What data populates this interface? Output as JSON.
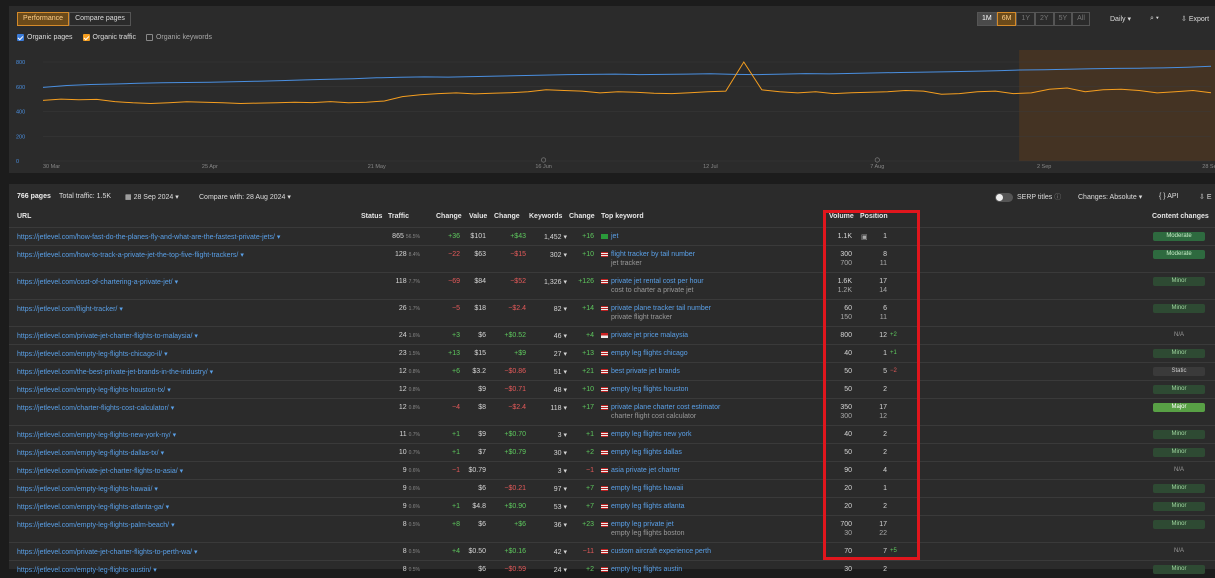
{
  "header": {
    "tabs": [
      {
        "label": "Performance",
        "active": true
      },
      {
        "label": "Compare pages",
        "active": false
      }
    ],
    "ranges": [
      {
        "label": "1M",
        "on": true
      },
      {
        "label": "6M",
        "on": true
      },
      {
        "label": "1Y",
        "on": false
      },
      {
        "label": "2Y",
        "on": false
      },
      {
        "label": "5Y",
        "on": false
      },
      {
        "label": "All",
        "on": false
      }
    ],
    "interval": "Daily",
    "export": "Export"
  },
  "metrics": {
    "organic_pages": "Organic pages",
    "organic_traffic": "Organic traffic",
    "organic_keywords": "Organic keywords"
  },
  "chart_data": {
    "type": "line",
    "y_ticks": [
      "800",
      "600",
      "400",
      "200",
      "0"
    ],
    "ylim": [
      0,
      800
    ],
    "x_ticks": [
      "30 Mar",
      "25 Apr",
      "21 May",
      "16 Jun",
      "12 Jul",
      "7 Aug",
      "2 Sep",
      "28 Sep"
    ],
    "series": [
      {
        "color": "#4a8fe0",
        "values": [
          595,
          610,
          618,
          622,
          628,
          632,
          634,
          636,
          640,
          645,
          650,
          655,
          660,
          665,
          672,
          676,
          680,
          678,
          682,
          686,
          690,
          694,
          698,
          700,
          702,
          698,
          700,
          702,
          705,
          700,
          698,
          702,
          706,
          704,
          708,
          712,
          715,
          718,
          722,
          726,
          730,
          735,
          738,
          742,
          745,
          748,
          750,
          752,
          758,
          765
        ]
      },
      {
        "color": "#f59e1f",
        "values": [
          490,
          500,
          495,
          498,
          480,
          470,
          465,
          470,
          478,
          475,
          470,
          465,
          468,
          470,
          475,
          472,
          480,
          470,
          475,
          485,
          520,
          535,
          545,
          550,
          542,
          548,
          552,
          560,
          575,
          570,
          565,
          550,
          560,
          555,
          548,
          545,
          552,
          560,
          565,
          800,
          575,
          560,
          550,
          560,
          545,
          552,
          555,
          560,
          570,
          565,
          540,
          545,
          560,
          565,
          545,
          550,
          580,
          590,
          560,
          575,
          580,
          570,
          550,
          560,
          570,
          552
        ]
      }
    ],
    "highlight_range": [
      "2 Sep",
      "28 Sep"
    ],
    "markers": [
      "16 Jun",
      "7 Aug"
    ]
  },
  "table": {
    "summary": {
      "pages": "766 pages",
      "total_traffic": "Total traffic: 1.5K",
      "date": "28 Sep 2024",
      "compare": "Compare with: 28 Aug 2024",
      "serp_titles": "SERP titles",
      "changes": "Changes: Absolute",
      "api": "API",
      "export_short": "E"
    },
    "columns": {
      "url": "URL",
      "status": "Status",
      "traffic": "Traffic",
      "change": "Change",
      "value": "Value",
      "value_change": "Change",
      "keywords": "Keywords",
      "kw_change": "Change",
      "top_keyword": "Top keyword",
      "volume": "Volume",
      "position": "Position",
      "content_changes": "Content changes"
    },
    "rows": [
      {
        "url": "https://jetlevel.com/how-fast-do-the-planes-fly-and-what-are-the-fastest-private-jets/",
        "traffic": "865",
        "traffic_pct": "56.5%",
        "change": "+36",
        "value": "$101",
        "value_change": "+$43",
        "keywords": "1,452",
        "kw_change": "+16",
        "flag": "br",
        "kw": "jet",
        "kw2": "",
        "volume": "1.1K",
        "volume2": "",
        "position": "1",
        "position2": "",
        "pos_delta": "",
        "content": "Moderate"
      },
      {
        "url": "https://jetlevel.com/how-to-track-a-private-jet-the-top-five-flight-trackers/",
        "traffic": "128",
        "traffic_pct": "8.4%",
        "change": "−22",
        "value": "$63",
        "value_change": "−$15",
        "keywords": "302",
        "kw_change": "+10",
        "flag": "us",
        "kw": "flight tracker by tail number",
        "kw2": "jet tracker",
        "volume": "300",
        "volume2": "700",
        "position": "8",
        "position2": "11",
        "pos_delta": "",
        "content": "Moderate"
      },
      {
        "url": "https://jetlevel.com/cost-of-chartering-a-private-jet/",
        "traffic": "118",
        "traffic_pct": "7.7%",
        "change": "−69",
        "value": "$84",
        "value_change": "−$52",
        "keywords": "1,326",
        "kw_change": "+126",
        "flag": "us",
        "kw": "private jet rental cost per hour",
        "kw2": "cost to charter a private jet",
        "volume": "1.6K",
        "volume2": "1.2K",
        "position": "17",
        "position2": "14",
        "pos_delta": "",
        "content": "Minor"
      },
      {
        "url": "https://jetlevel.com/flight-tracker/",
        "traffic": "26",
        "traffic_pct": "1.7%",
        "change": "−5",
        "value": "$18",
        "value_change": "−$2.4",
        "keywords": "82",
        "kw_change": "+14",
        "flag": "us",
        "kw": "private plane tracker tail number",
        "kw2": "private flight tracker",
        "volume": "60",
        "volume2": "150",
        "position": "6",
        "position2": "11",
        "pos_delta": "",
        "content": "Minor"
      },
      {
        "url": "https://jetlevel.com/private-jet-charter-flights-to-malaysia/",
        "traffic": "24",
        "traffic_pct": "1.6%",
        "change": "+3",
        "value": "$6",
        "value_change": "+$0.52",
        "keywords": "46",
        "kw_change": "+4",
        "flag": "my",
        "kw": "private jet price malaysia",
        "kw2": "",
        "volume": "800",
        "volume2": "",
        "position": "12",
        "position2": "",
        "pos_delta": "+2",
        "content": "N/A"
      },
      {
        "url": "https://jetlevel.com/empty-leg-flights-chicago-il/",
        "traffic": "23",
        "traffic_pct": "1.5%",
        "change": "+13",
        "value": "$15",
        "value_change": "+$9",
        "keywords": "27",
        "kw_change": "+13",
        "flag": "us",
        "kw": "empty leg flights chicago",
        "kw2": "",
        "volume": "40",
        "volume2": "",
        "position": "1",
        "position2": "",
        "pos_delta": "+1",
        "content": "Minor"
      },
      {
        "url": "https://jetlevel.com/the-best-private-jet-brands-in-the-industry/",
        "traffic": "12",
        "traffic_pct": "0.8%",
        "change": "+6",
        "value": "$3.2",
        "value_change": "−$0.86",
        "keywords": "51",
        "kw_change": "+21",
        "flag": "us",
        "kw": "best private jet brands",
        "kw2": "",
        "volume": "50",
        "volume2": "",
        "position": "5",
        "position2": "",
        "pos_delta": "−2",
        "content": "Static"
      },
      {
        "url": "https://jetlevel.com/empty-leg-flights-houston-tx/",
        "traffic": "12",
        "traffic_pct": "0.8%",
        "change": "",
        "value": "$9",
        "value_change": "−$0.71",
        "keywords": "48",
        "kw_change": "+10",
        "flag": "us",
        "kw": "empty leg flights houston",
        "kw2": "",
        "volume": "50",
        "volume2": "",
        "position": "2",
        "position2": "",
        "pos_delta": "",
        "content": "Minor"
      },
      {
        "url": "https://jetlevel.com/charter-flights-cost-calculator/",
        "traffic": "12",
        "traffic_pct": "0.8%",
        "change": "−4",
        "value": "$8",
        "value_change": "−$2.4",
        "keywords": "118",
        "kw_change": "+17",
        "flag": "us",
        "kw": "private plane charter cost estimator",
        "kw2": "charter flight cost calculator",
        "volume": "350",
        "volume2": "300",
        "position": "17",
        "position2": "12",
        "pos_delta": "",
        "content": "Major"
      },
      {
        "url": "https://jetlevel.com/empty-leg-flights-new-york-ny/",
        "traffic": "11",
        "traffic_pct": "0.7%",
        "change": "+1",
        "value": "$9",
        "value_change": "+$0.70",
        "keywords": "3",
        "kw_change": "+1",
        "flag": "us",
        "kw": "empty leg flights new york",
        "kw2": "",
        "volume": "40",
        "volume2": "",
        "position": "2",
        "position2": "",
        "pos_delta": "",
        "content": "Minor"
      },
      {
        "url": "https://jetlevel.com/empty-leg-flights-dallas-tx/",
        "traffic": "10",
        "traffic_pct": "0.7%",
        "change": "+1",
        "value": "$7",
        "value_change": "+$0.79",
        "keywords": "30",
        "kw_change": "+2",
        "flag": "us",
        "kw": "empty leg flights dallas",
        "kw2": "",
        "volume": "50",
        "volume2": "",
        "position": "2",
        "position2": "",
        "pos_delta": "",
        "content": "Minor"
      },
      {
        "url": "https://jetlevel.com/private-jet-charter-flights-to-asia/",
        "traffic": "9",
        "traffic_pct": "0.6%",
        "change": "−1",
        "value": "$0.79",
        "value_change": "",
        "keywords": "3",
        "kw_change": "−1",
        "flag": "us",
        "kw": "asia private jet charter",
        "kw2": "",
        "volume": "90",
        "volume2": "",
        "position": "4",
        "position2": "",
        "pos_delta": "",
        "content": "N/A"
      },
      {
        "url": "https://jetlevel.com/empty-leg-flights-hawaii/",
        "traffic": "9",
        "traffic_pct": "0.6%",
        "change": "",
        "value": "$6",
        "value_change": "−$0.21",
        "keywords": "97",
        "kw_change": "+7",
        "flag": "us",
        "kw": "empty leg flights hawaii",
        "kw2": "",
        "volume": "20",
        "volume2": "",
        "position": "1",
        "position2": "",
        "pos_delta": "",
        "content": "Minor"
      },
      {
        "url": "https://jetlevel.com/empty-leg-flights-atlanta-ga/",
        "traffic": "9",
        "traffic_pct": "0.6%",
        "change": "+1",
        "value": "$4.8",
        "value_change": "+$0.90",
        "keywords": "53",
        "kw_change": "+7",
        "flag": "us",
        "kw": "empty leg flights atlanta",
        "kw2": "",
        "volume": "20",
        "volume2": "",
        "position": "2",
        "position2": "",
        "pos_delta": "",
        "content": "Minor"
      },
      {
        "url": "https://jetlevel.com/empty-leg-flights-palm-beach/",
        "traffic": "8",
        "traffic_pct": "0.5%",
        "change": "+8",
        "value": "$6",
        "value_change": "+$6",
        "keywords": "36",
        "kw_change": "+23",
        "flag": "us",
        "kw": "empty leg private jet",
        "kw2": "empty leg flights boston",
        "volume": "700",
        "volume2": "30",
        "position": "17",
        "position2": "22",
        "pos_delta": "",
        "content": "Minor"
      },
      {
        "url": "https://jetlevel.com/private-jet-charter-flights-to-perth-wa/",
        "traffic": "8",
        "traffic_pct": "0.5%",
        "change": "+4",
        "value": "$0.50",
        "value_change": "+$0.16",
        "keywords": "42",
        "kw_change": "−11",
        "flag": "us",
        "kw": "custom aircraft experience perth",
        "kw2": "",
        "volume": "70",
        "volume2": "",
        "position": "7",
        "position2": "",
        "pos_delta": "+5",
        "content": "N/A"
      },
      {
        "url": "https://jetlevel.com/empty-leg-flights-austin/",
        "traffic": "8",
        "traffic_pct": "0.5%",
        "change": "",
        "value": "$6",
        "value_change": "−$0.59",
        "keywords": "24",
        "kw_change": "+2",
        "flag": "us",
        "kw": "empty leg flights austin",
        "kw2": "",
        "volume": "30",
        "volume2": "",
        "position": "2",
        "position2": "",
        "pos_delta": "",
        "content": "Minor"
      }
    ]
  }
}
